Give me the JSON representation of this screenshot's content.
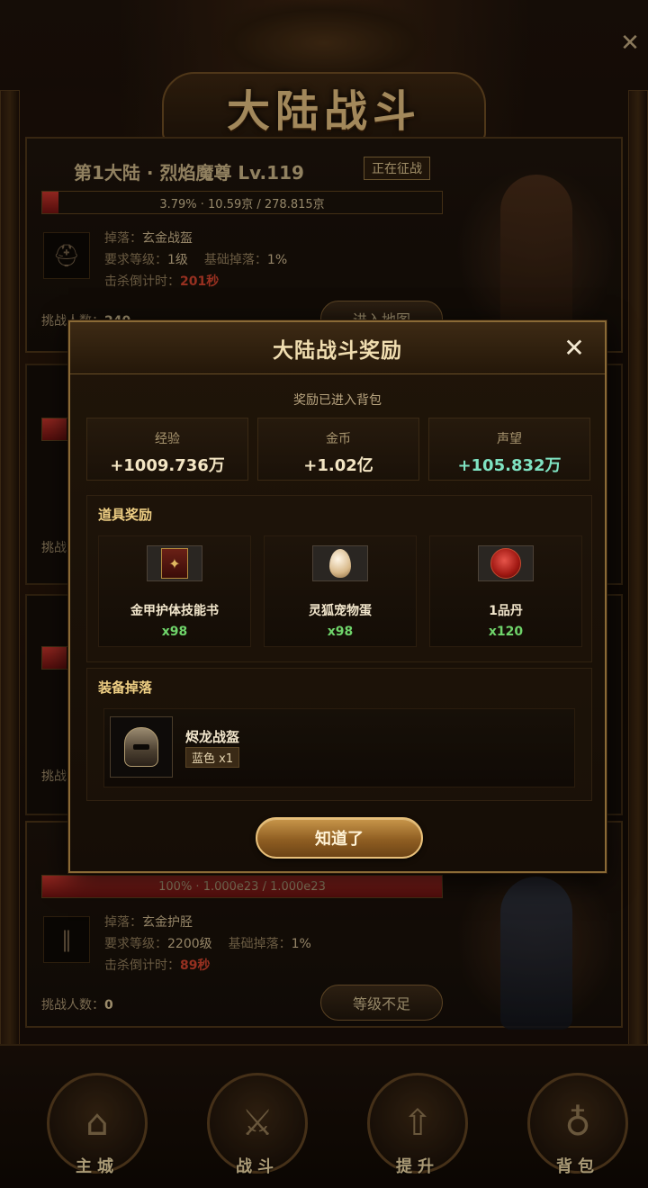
{
  "screen": {
    "title": "大陆战斗",
    "close_glyph": "✕"
  },
  "cards": [
    {
      "title": "第1大陆 · 烈焰魔尊 Lv.119",
      "status": "正在征战",
      "progress_text": "3.79% · 10.59京 / 278.815京",
      "progress_fraction": 0.0379,
      "drop_label": "掉落：",
      "drop_value": "玄金战盔",
      "level_label": "要求等级：",
      "level_value": "1级",
      "base_drop_label": "基础掉落：",
      "base_drop_value": "1%",
      "countdown_label": "击杀倒计时：",
      "countdown_value": "201秒",
      "challengers_label": "挑战人数：",
      "challengers_value": "240",
      "button": "进入地图"
    },
    {
      "progress_text": "100% · 1.000e23 / 1.000e23",
      "progress_fraction": 1.0,
      "drop_label": "掉落：",
      "drop_value": "玄金护胫",
      "level_label": "要求等级：",
      "level_value": "2200级",
      "base_drop_label": "基础掉落：",
      "base_drop_value": "1%",
      "countdown_label": "击杀倒计时：",
      "countdown_value": "89秒",
      "challengers_label": "挑战人数：",
      "challengers_value": "0",
      "button": "等级不足"
    }
  ],
  "ghost_labels": [
    "挑战",
    "挑战"
  ],
  "bottom_nav": [
    {
      "label": "主城",
      "icon": "city-icon"
    },
    {
      "label": "战斗",
      "icon": "crossed-swords-icon"
    },
    {
      "label": "提升",
      "icon": "upgrade-arrow-icon"
    },
    {
      "label": "背包",
      "icon": "bag-icon"
    }
  ],
  "modal": {
    "title": "大陆战斗奖励",
    "close_glyph": "✕",
    "subtitle": "奖励已进入背包",
    "stats": [
      {
        "label": "经验",
        "value": "+1009.736万",
        "color": "#f4e6c4"
      },
      {
        "label": "金币",
        "value": "+1.02亿",
        "color": "#f4e6c4"
      },
      {
        "label": "声望",
        "value": "+105.832万",
        "color": "#7fe3c2"
      }
    ],
    "items_title": "道具奖励",
    "items": [
      {
        "name": "金甲护体技能书",
        "qty": "x98",
        "icon": "skill-book-icon"
      },
      {
        "name": "灵狐宠物蛋",
        "qty": "x98",
        "icon": "pet-egg-icon"
      },
      {
        "name": "1品丹",
        "qty": "x120",
        "icon": "pill-icon"
      }
    ],
    "equip_title": "装备掉落",
    "equip": {
      "name": "烬龙战盔",
      "tag": "蓝色 x1",
      "icon": "helmet-icon"
    },
    "ok_button": "知道了"
  }
}
